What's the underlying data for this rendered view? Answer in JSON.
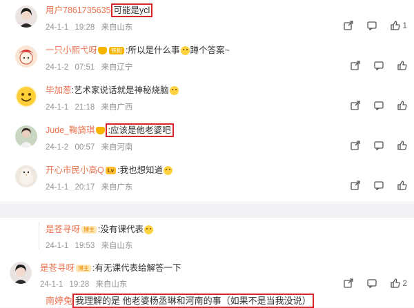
{
  "comments_top": [
    {
      "username": "用户7861735635",
      "text": "可能是ycl",
      "date": "24-1-1",
      "time": "19:28",
      "location": "来自山东",
      "likes": "1",
      "avatar": "avatar-woman"
    },
    {
      "username": "一只小熙弋呀",
      "badge": "铁粉",
      "text": ":所以是什么事",
      "text2": "蹲个答案~",
      "date": "24-1-2",
      "time": "07:51",
      "location": "来自辽宁",
      "avatar": "avatar-cartoon"
    },
    {
      "username": "毕加葱",
      "text": ":艺术家说话就是神秘烧脑",
      "date": "24-1-1",
      "time": "21:18",
      "location": "来自广西",
      "avatar": "avatar-smiley"
    },
    {
      "username": "Jude_鞠旖琪",
      "text": ":应该是他老婆吧",
      "date": "24-1-2",
      "time": "00:57",
      "location": "来自河南",
      "avatar": "avatar-photo"
    },
    {
      "username": "开心市民小高Q",
      "badge": "Lv",
      "text": ":我也想知道",
      "date": "24-1-1",
      "time": "20:17",
      "location": "来自广东",
      "avatar": "avatar-bird"
    }
  ],
  "comments_bottom": [
    {
      "username": "是苍寻呀",
      "badge": "博主",
      "text": ":没有课代表",
      "date": "24-1-1",
      "time": "19:53",
      "location": "来自山东"
    },
    {
      "username": "是苍寻呀",
      "badge": "博主",
      "text": ":有无课代表给解答一下",
      "date": "24-1-1",
      "time": "19:28",
      "location": "来自山东",
      "likes": "2",
      "avatar": "avatar-woman"
    },
    {
      "username": "南婷兔",
      "text": "我理解的是 他老婆杨丞琳和河南的事（如果不是当我没说）"
    }
  ],
  "icons": [
    "share-icon",
    "comment-icon",
    "like-icon"
  ],
  "colors": {
    "username": "#eb7350",
    "highlight": "#d9252a",
    "meta": "#939393"
  }
}
